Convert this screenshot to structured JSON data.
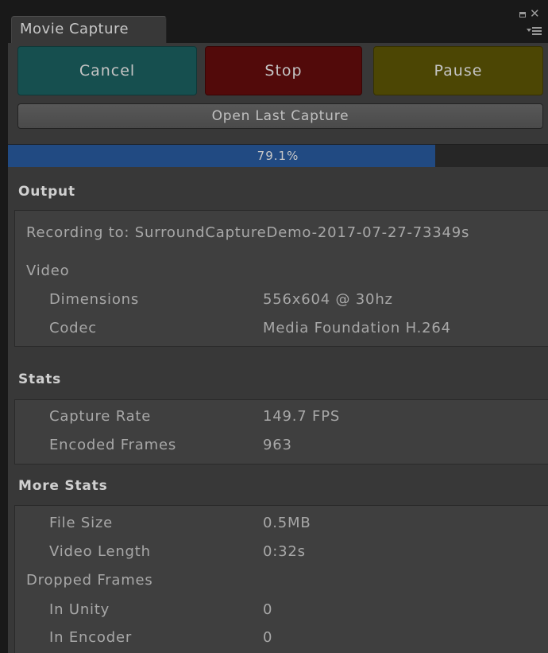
{
  "window": {
    "tab_label": "Movie Capture"
  },
  "buttons": {
    "cancel": "Cancel",
    "stop": "Stop",
    "pause": "Pause",
    "open_last_capture": "Open Last Capture"
  },
  "progress": {
    "label": "79.1%",
    "value": 0.791
  },
  "output": {
    "header": "Output",
    "recording_to": "Recording to: SurroundCaptureDemo-2017-07-27-73349s",
    "video_label": "Video",
    "dimensions_label": "Dimensions",
    "dimensions_value": "556x604 @ 30hz",
    "codec_label": "Codec",
    "codec_value": "Media Foundation H.264"
  },
  "stats": {
    "header": "Stats",
    "capture_rate_label": "Capture Rate",
    "capture_rate_value": "149.7 FPS",
    "encoded_frames_label": "Encoded Frames",
    "encoded_frames_value": "963"
  },
  "more_stats": {
    "header": "More Stats",
    "file_size_label": "File Size",
    "file_size_value": "0.5MB",
    "video_length_label": "Video Length",
    "video_length_value": "0:32s",
    "dropped_frames_label": "Dropped Frames",
    "in_unity_label": "In Unity",
    "in_unity_value": "0",
    "in_encoder_label": "In Encoder",
    "in_encoder_value": "0"
  },
  "colors": {
    "cancel": "#164f4f",
    "stop": "#520a0a",
    "pause": "#4c4604",
    "progress_fill": "#214a82"
  },
  "icons": [
    "maximize-icon",
    "close-icon",
    "window-menu-icon"
  ]
}
